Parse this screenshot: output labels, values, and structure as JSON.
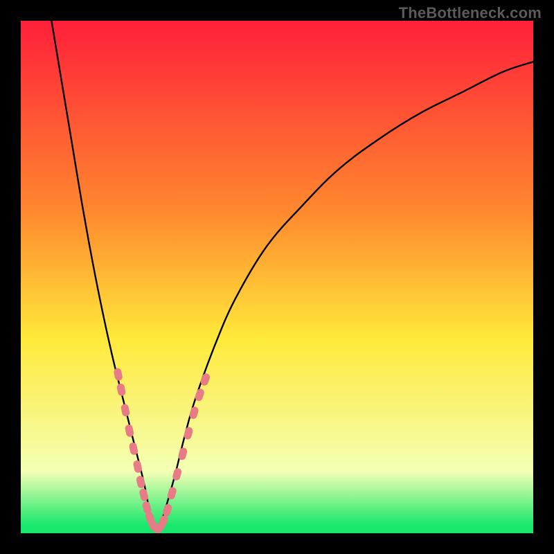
{
  "watermark": {
    "text": "TheBottleneck.com"
  },
  "colors": {
    "top": "#ff1f3a",
    "orange": "#ff8b2e",
    "yellow": "#ffe93a",
    "pale": "#f3ffb4",
    "green": "#17e86b",
    "marker": "#e77c86",
    "curve": "#000000",
    "frame": "#000000"
  },
  "chart_data": {
    "type": "line",
    "title": "",
    "xlabel": "",
    "ylabel": "",
    "xlim": [
      0,
      100
    ],
    "ylim": [
      0,
      100
    ],
    "grid": false,
    "series": [
      {
        "name": "bottleneck-curve",
        "note": "V-shaped curve; y≈bottleneck %, x≈component balance point. Values estimated from pixel positions; chart has no numeric axis labels so domain is normalized 0–100.",
        "x": [
          6,
          8,
          10,
          12,
          14,
          16,
          18,
          20,
          22,
          24,
          25,
          26,
          27,
          28,
          30,
          32,
          34,
          38,
          42,
          48,
          55,
          62,
          70,
          78,
          86,
          94,
          100
        ],
        "y": [
          100,
          88,
          76,
          64,
          53,
          43,
          34,
          26,
          18,
          10,
          5,
          1,
          1,
          4,
          11,
          19,
          26,
          37,
          46,
          56,
          64,
          71,
          77,
          82,
          86,
          90,
          92
        ]
      }
    ],
    "markers": {
      "name": "data-points",
      "note": "Pink segment markers overlaid near the curve minimum on both branches.",
      "points": [
        {
          "x": 19.0,
          "y": 31
        },
        {
          "x": 19.6,
          "y": 28
        },
        {
          "x": 20.4,
          "y": 24
        },
        {
          "x": 21.2,
          "y": 20
        },
        {
          "x": 22.0,
          "y": 16.5
        },
        {
          "x": 22.8,
          "y": 13
        },
        {
          "x": 23.4,
          "y": 10
        },
        {
          "x": 24.0,
          "y": 7.5
        },
        {
          "x": 24.6,
          "y": 5
        },
        {
          "x": 25.2,
          "y": 3
        },
        {
          "x": 25.8,
          "y": 1.6
        },
        {
          "x": 26.4,
          "y": 1.0
        },
        {
          "x": 27.0,
          "y": 1.0
        },
        {
          "x": 27.8,
          "y": 2.3
        },
        {
          "x": 28.6,
          "y": 4.5
        },
        {
          "x": 29.5,
          "y": 7.8
        },
        {
          "x": 30.5,
          "y": 11.5
        },
        {
          "x": 31.6,
          "y": 15.5
        },
        {
          "x": 32.7,
          "y": 19.5
        },
        {
          "x": 33.8,
          "y": 23.5
        },
        {
          "x": 34.9,
          "y": 27
        },
        {
          "x": 36.0,
          "y": 30
        }
      ]
    },
    "gradient_stops": [
      {
        "pos": 0.0,
        "color": "#ff1f3a"
      },
      {
        "pos": 0.38,
        "color": "#ff8b2e"
      },
      {
        "pos": 0.62,
        "color": "#ffe93a"
      },
      {
        "pos": 0.88,
        "color": "#f3ffb4"
      },
      {
        "pos": 0.985,
        "color": "#17e86b"
      }
    ]
  }
}
